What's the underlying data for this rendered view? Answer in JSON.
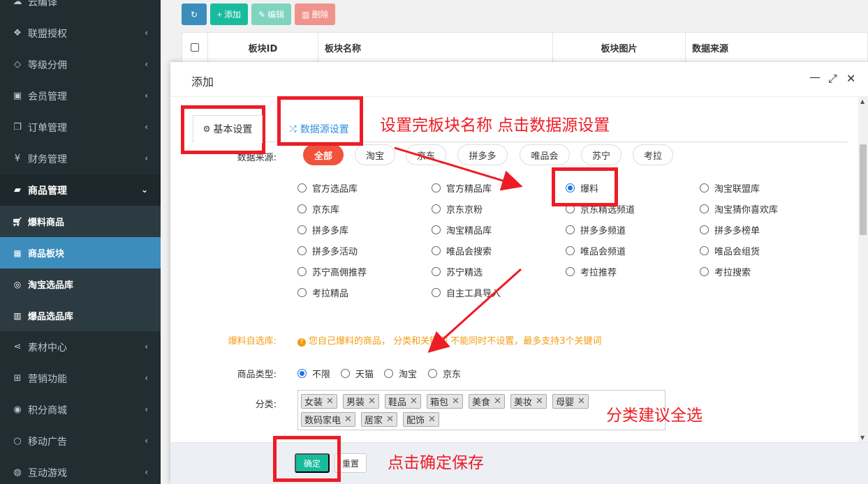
{
  "sidebar": {
    "items": [
      {
        "label": "云编译",
        "icon": "cloud-icon"
      },
      {
        "label": "联盟授权",
        "icon": "cubes-icon"
      },
      {
        "label": "等级分佣",
        "icon": "diamond-icon"
      },
      {
        "label": "会员管理",
        "icon": "user-card-icon"
      },
      {
        "label": "订单管理",
        "icon": "copy-icon"
      },
      {
        "label": "财务管理",
        "icon": "yen-icon"
      },
      {
        "label": "商品管理",
        "icon": "briefcase-icon"
      },
      {
        "label": "素材中心",
        "icon": "share-icon"
      },
      {
        "label": "营销功能",
        "icon": "gift-icon"
      },
      {
        "label": "积分商城",
        "icon": "chrome-icon"
      },
      {
        "label": "移动广告",
        "icon": "circle-icon"
      },
      {
        "label": "互动游戏",
        "icon": "game-icon"
      }
    ],
    "sub_items": [
      {
        "label": "爆料商品",
        "icon": "cart-icon"
      },
      {
        "label": "商品板块",
        "icon": "grid-icon"
      },
      {
        "label": "淘宝选品库",
        "icon": "target-icon"
      },
      {
        "label": "爆品选品库",
        "icon": "bar-chart-icon"
      }
    ]
  },
  "toolbar": {
    "add_label": "添加",
    "edit_label": "编辑",
    "delete_label": "删除"
  },
  "table": {
    "columns": [
      "板块ID",
      "板块名称",
      "板块图片",
      "数据来源"
    ]
  },
  "modal": {
    "title": "添加",
    "tabs": [
      "基本设置",
      "数据源设置"
    ],
    "source_label": "数据来源:",
    "source_chips": [
      "全部",
      "淘宝",
      "京东",
      "拼多多",
      "唯品会",
      "苏宁",
      "考拉"
    ],
    "radio_rows": [
      [
        "官方选品库",
        "官方精品库",
        "爆料",
        "淘宝联盟库"
      ],
      [
        "京东库",
        "京东京粉",
        "京东精选频道",
        "淘宝猜你喜欢库"
      ],
      [
        "拼多多库",
        "淘宝精品库",
        "拼多多频道",
        "拼多多榜单"
      ],
      [
        "拼多多活动",
        "唯品会搜索",
        "唯品会频道",
        "唯品会组货"
      ],
      [
        "苏宁高佣推荐",
        "苏宁精选",
        "考拉推荐",
        "考拉搜索"
      ],
      [
        "考拉精品",
        "自主工具导入"
      ]
    ],
    "selected_source": "爆料",
    "self_library_label": "爆料自选库:",
    "self_library_note": "您自己爆料的商品， 分类和关键词 不能同时不设置，最多支持3个关键词",
    "goods_type_label": "商品类型:",
    "goods_types": [
      "不限",
      "天猫",
      "淘宝",
      "京东"
    ],
    "selected_goods_type": "不限",
    "category_label": "分类:",
    "categories_row1": [
      "女装",
      "男装",
      "鞋品",
      "箱包",
      "美食",
      "美妆",
      "母婴"
    ],
    "categories_row2": [
      "数码家电",
      "居家",
      "配饰"
    ],
    "confirm_label": "确定",
    "reset_label": "重置"
  },
  "annotations": {
    "step1": "设置完板块名称 点击数据源设置",
    "step2": "分类建议全选",
    "step3": "点击确定保存",
    "accent": "#ee1c25"
  },
  "colors": {
    "sidebar_bg": "#222d32",
    "active_blue": "#3c8dbc",
    "primary_green": "#18bc9c",
    "chip_active": "#f1523b"
  }
}
